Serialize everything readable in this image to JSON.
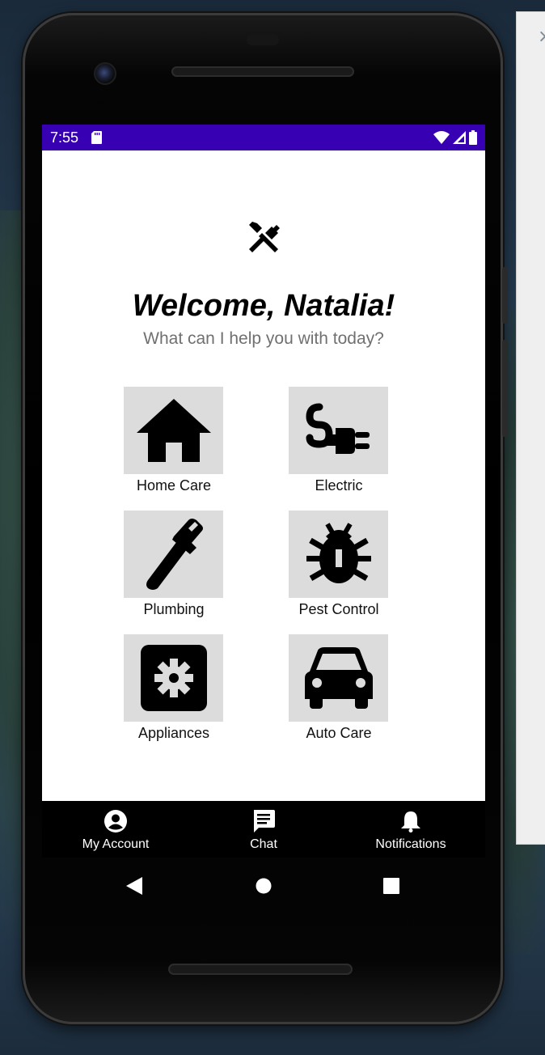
{
  "status_bar": {
    "time": "7:55",
    "color": "#3700b3"
  },
  "header": {
    "app_icon": "tools-icon",
    "welcome": "Welcome, Natalia!",
    "subtitle": "What can I help you with today?"
  },
  "services": [
    {
      "label": "Home Care",
      "icon": "home-icon"
    },
    {
      "label": "Electric",
      "icon": "electric-plug-icon"
    },
    {
      "label": "Plumbing",
      "icon": "pipe-wrench-icon"
    },
    {
      "label": "Pest Control",
      "icon": "bug-icon"
    },
    {
      "label": "Appliances",
      "icon": "gear-icon"
    },
    {
      "label": "Auto Care",
      "icon": "car-icon"
    }
  ],
  "bottom_nav": {
    "items": [
      {
        "label": "My Account",
        "icon": "account-circle-icon"
      },
      {
        "label": "Chat",
        "icon": "chat-icon"
      },
      {
        "label": "Notifications",
        "icon": "bell-icon"
      }
    ]
  },
  "system_nav": {
    "back": "back-icon",
    "home": "home-circle-icon",
    "recents": "recents-icon"
  },
  "side_panel": {
    "close_glyph": "×"
  }
}
